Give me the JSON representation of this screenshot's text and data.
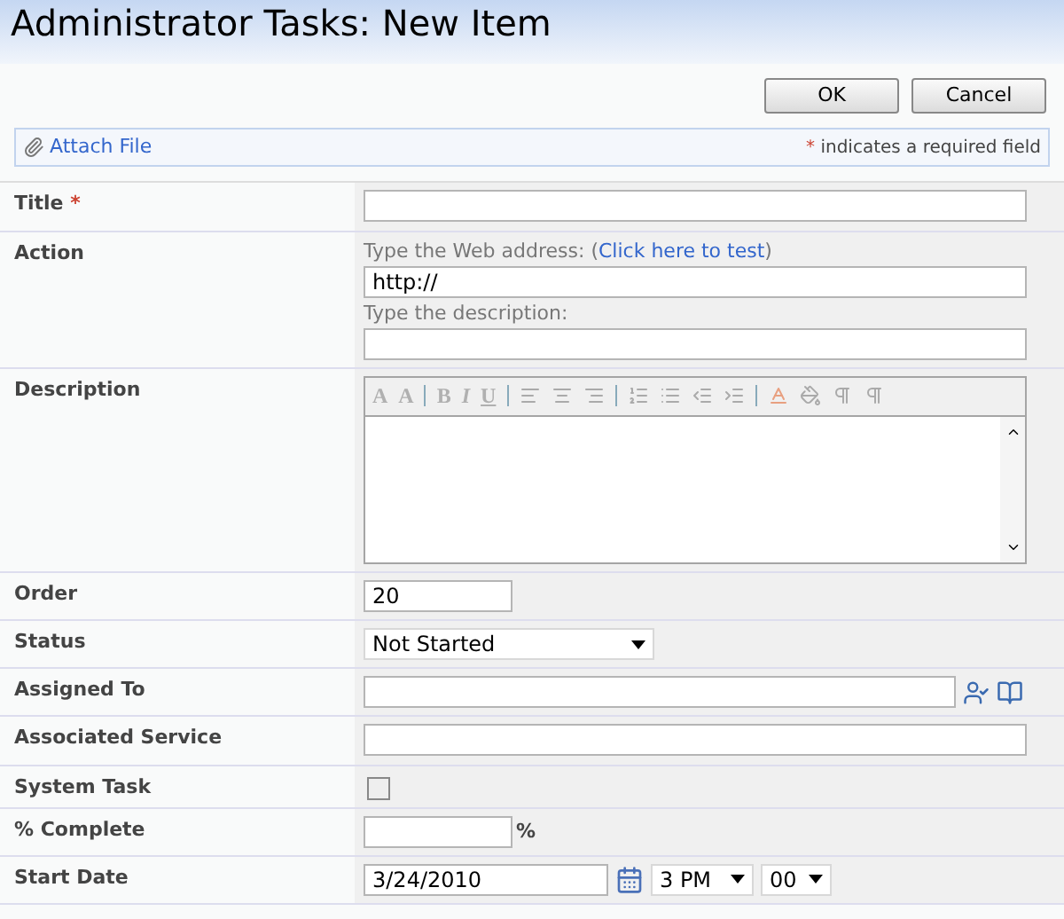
{
  "title": "Administrator Tasks: New Item",
  "buttons": [
    "OK",
    "Cancel"
  ],
  "attach": {
    "label": "Attach File",
    "required_mark": "*",
    "required_note": "indicates a required field"
  },
  "fields": [
    {
      "kind": "text",
      "label": "Title",
      "required": true
    },
    {
      "kind": "url",
      "label": "Action",
      "required": false,
      "url_hint": "Type the Web address: (",
      "test_link": "Click here to test",
      "url_hint_end": ")",
      "value": "http://",
      "desc_hint": "Type the description:"
    },
    {
      "kind": "richtext",
      "label": "Description",
      "required": false,
      "toolbar": [
        "A",
        "A",
        "B",
        "I",
        "U"
      ]
    },
    {
      "kind": "number",
      "label": "Order",
      "required": false,
      "value": "20"
    },
    {
      "kind": "select",
      "label": "Status",
      "required": false,
      "value": "Not Started"
    },
    {
      "kind": "people",
      "label": "Assigned To",
      "required": false
    },
    {
      "kind": "text",
      "label": "Associated Service",
      "required": false
    },
    {
      "kind": "checkbox",
      "label": "System Task",
      "required": false,
      "checked": false
    },
    {
      "kind": "percent",
      "label": "% Complete",
      "required": false,
      "suffix": "%"
    },
    {
      "kind": "datetime",
      "label": "Start Date",
      "required": false,
      "value": "3/24/2010",
      "hour": "3 PM",
      "minute": "00"
    }
  ]
}
